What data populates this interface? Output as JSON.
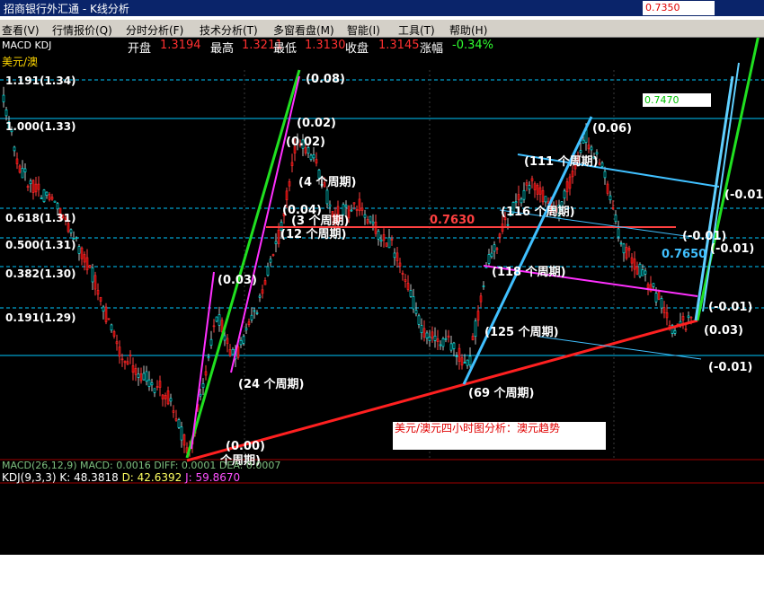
{
  "app": {
    "title_left": "招商银行外汇通 - K线分析",
    "corner_value": "0.7350"
  },
  "menu": {
    "items": [
      "查看(V)",
      "行情报价(Q)",
      "分时分析(F)",
      "技术分析(T)",
      "多窗看盘(M)",
      "智能(I)",
      "工具(T)",
      "帮助(H)"
    ]
  },
  "quote": {
    "indicators": "MACD KDJ",
    "open_label": "开盘",
    "open": "1.3194",
    "high_label": "最高",
    "high": "1.3211",
    "low_label": "最低",
    "low": "1.3130",
    "close_label": "收盘",
    "close": "1.3145",
    "change_label": "涨幅",
    "change": "-0.34%"
  },
  "symbol": "美元/澳",
  "price_axis": [
    "1.191(1.34)",
    "1.000(1.33)",
    "0.618(1.31)",
    "0.500(1.31)",
    "0.382(1.30)",
    "0.191(1.29)"
  ],
  "annotations": {
    "a_008": "(0.08)",
    "a_002a": "(0.02)",
    "a_002b": "(0.02)",
    "a_4p": "(4 个周期)",
    "a_004": "(0.04)",
    "a_3p": "(3 个周期)",
    "a_overlap": "(12 个周期)",
    "a_7630": "0.7630",
    "a_003a": "(0.03)",
    "a_24p": "(24 个周期)",
    "a_006": "(0.06)",
    "a_111p": "(111 个周期)",
    "a_116p": "(116 个周期)",
    "a_118p": "(118 个周期)",
    "a_125p": "(125 个周期)",
    "a_69p": "(69 个周期)",
    "a_m001a": "(-0.01)",
    "a_m001b": "(-0.01)",
    "a_m001c": "(-0.01)",
    "a_m001d": "(-0.01)",
    "a_m001e": "(-0.01)",
    "a_7650": "0.7650",
    "a_003b": "(0.03)",
    "a_000": "(0.00)",
    "a_bottom_p": "个周期)"
  },
  "note_text": "美元/澳元四小时图分析：澳元趋势",
  "input_value": "0.7470",
  "macd_line": "MACD(26,12,9) MACD: 0.0016 DIFF: 0.0001 DEA: 0.0007",
  "kdj": {
    "label": "KDJ(9,3,3)",
    "k": "K: 48.3818",
    "d": "D: 42.6392",
    "j": "J: 59.8670"
  },
  "colors": {
    "titlebar": "#0a246a",
    "up_candle": "#ff3030",
    "down_candle": "#00ffff",
    "fib_line": "#00c8ff",
    "trend_red": "#ff2020",
    "trend_green": "#20e020",
    "trend_magenta": "#ff30ff",
    "trend_cyan": "#40c0ff"
  }
}
